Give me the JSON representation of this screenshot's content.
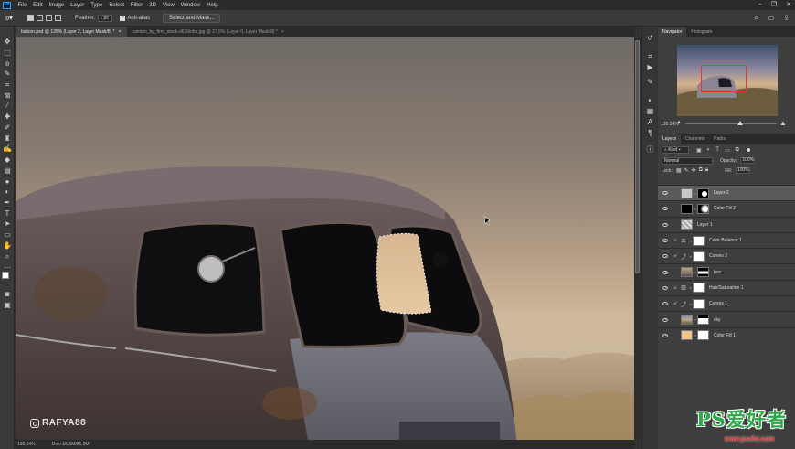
{
  "menubar": {
    "logo": "Ps",
    "items": [
      "File",
      "Edit",
      "Image",
      "Layer",
      "Type",
      "Select",
      "Filter",
      "3D",
      "View",
      "Window",
      "Help"
    ]
  },
  "options": {
    "feather_label": "Feather:",
    "feather_value": "1 px",
    "antialias_label": "Anti-alias",
    "select_mask_label": "Select and Mask..."
  },
  "doc_tabs": [
    {
      "label": "baloon.psd @ 135% (Layer 2, Layer Mask/8) *",
      "close": "×"
    },
    {
      "label": "camion_by_firm_stock-d63i6nbs.jpg @ 27,5% (Layer 0, Layer Mask/8) *",
      "close": "×"
    }
  ],
  "status": {
    "zoom": "135.24%",
    "doc": "Doc: 15,5M/81,2M"
  },
  "watermark": {
    "instagram_handle": "RAFYA88"
  },
  "navigator": {
    "tabs": [
      "Navigator",
      "Histogram"
    ],
    "zoom": "135.24%"
  },
  "layers_panel": {
    "tabs": [
      "Layers",
      "Channels",
      "Paths"
    ],
    "kind_label": "Kind",
    "blend_mode": "Normal",
    "opacity_label": "Opacity:",
    "opacity_value": "100%",
    "lock_label": "Lock:",
    "fill_label": "Fill:",
    "fill_value": "100%",
    "layers": [
      {
        "name": "Layer 2",
        "selected": true
      },
      {
        "name": "Color Fill 2"
      },
      {
        "name": "Layer 1"
      },
      {
        "name": "Color Balance 1"
      },
      {
        "name": "Curves 2"
      },
      {
        "name": "bus"
      },
      {
        "name": "Hue/Saturation 1"
      },
      {
        "name": "Curves 1"
      },
      {
        "name": "sky"
      },
      {
        "name": "Color Fill 1"
      }
    ]
  },
  "site_watermark": {
    "logo_text": "PS爱好者",
    "url": "www.psahz.com"
  }
}
